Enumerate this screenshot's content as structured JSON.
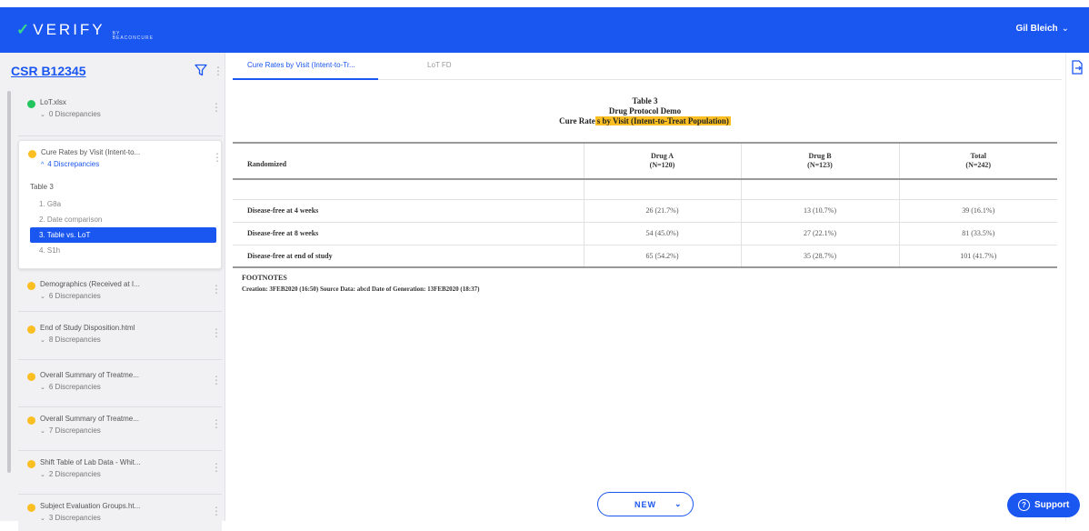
{
  "header": {
    "logo_text": "VERIFY",
    "logo_check": "✓",
    "logo_sub": "BY BEACONCURE",
    "user_name": "Gil Bleich",
    "user_chevron": "⌄"
  },
  "sidebar": {
    "title": "CSR B12345",
    "items": [
      {
        "name": "LoT.xlsx",
        "discrepancies": "0 Discrepancies",
        "status_color": "#22c55e"
      },
      {
        "name": "Cure Rates by Visit (Intent-to...",
        "discrepancies": "4 Discrepancies",
        "status_color": "#fbbf24"
      },
      {
        "name": "Demographics (Received at I...",
        "discrepancies": "6 Discrepancies",
        "status_color": "#fbbf24"
      },
      {
        "name": "End of Study Disposition.html",
        "discrepancies": "8 Discrepancies",
        "status_color": "#fbbf24"
      },
      {
        "name": "Overall Summary of Treatme...",
        "discrepancies": "6 Discrepancies",
        "status_color": "#fbbf24"
      },
      {
        "name": "Overall Summary of Treatme...",
        "discrepancies": "7 Discrepancies",
        "status_color": "#fbbf24"
      },
      {
        "name": "Shift Table of Lab Data - Whit...",
        "discrepancies": "2 Discrepancies",
        "status_color": "#fbbf24"
      },
      {
        "name": "Subject Evaluation Groups.ht...",
        "discrepancies": "3 Discrepancies",
        "status_color": "#fbbf24"
      }
    ],
    "open_item": {
      "section": "Table 3",
      "subitems": [
        "1. G8a",
        "2. Date comparison",
        "3. Table vs. LoT",
        "4. S1h"
      ],
      "active_index": 2
    },
    "expand_down": "⌄",
    "expand_up": "^"
  },
  "tabs": [
    {
      "label": "Cure Rates by Visit (Intent-to-Tr...",
      "active": true
    },
    {
      "label": "LoT FD",
      "active": false
    }
  ],
  "document": {
    "heading_line1": "Table 3",
    "heading_line2": "Drug Protocol Demo",
    "heading_line3_plain": "Cure Rate",
    "heading_line3_highlight": "s by Visit (Intent-to-Treat Population)",
    "columns": [
      {
        "name": "Randomized",
        "n": ""
      },
      {
        "name": "Drug A",
        "n": "(N=120)"
      },
      {
        "name": "Drug B",
        "n": "(N=123)"
      },
      {
        "name": "Total",
        "n": "(N=242)"
      }
    ],
    "rows": [
      {
        "label": "Disease-free at 4 weeks",
        "drug_a": "26  (21.7%)",
        "drug_b": "13  (10.7%)",
        "total": "39  (16.1%)"
      },
      {
        "label": "Disease-free at 8 weeks",
        "drug_a": "54  (45.0%)",
        "drug_b": "27  (22.1%)",
        "total": "81  (33.5%)"
      },
      {
        "label": "Disease-free at end of study",
        "drug_a": "65  (54.2%)",
        "drug_b": "35  (28.7%)",
        "total": "101  (41.7%)"
      }
    ],
    "footnotes_title": "FOOTNOTES",
    "footnote_line": "Creation: 3FEB2020 (16:50) Source Data: abcd Date of Generation: 13FEB2020 (18:37)"
  },
  "buttons": {
    "new_label": "NEW",
    "new_chevron": "⌄",
    "support_label": "Support",
    "support_icon": "?"
  },
  "colors": {
    "brand": "#1a56f0",
    "highlight": "#fbbf24",
    "ok": "#22c55e"
  }
}
